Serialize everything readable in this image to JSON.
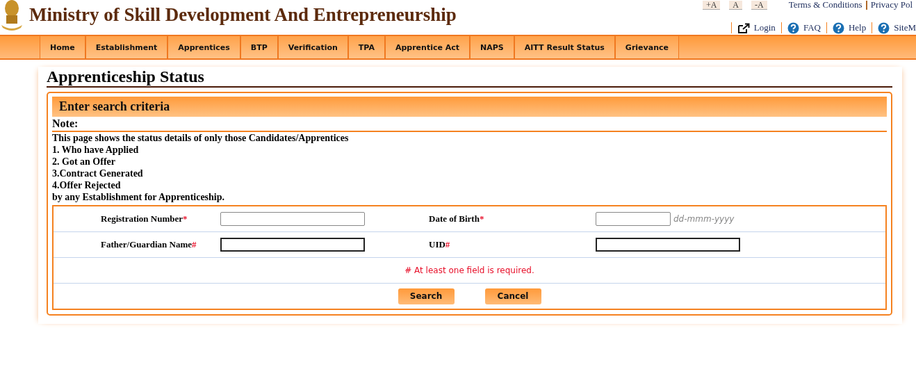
{
  "header": {
    "title": "Ministry of Skill Development And Entrepreneurship"
  },
  "font_size_buttons": [
    "+A",
    "A",
    "-A"
  ],
  "top_links": [
    "Terms & Conditions",
    "Privacy Pol"
  ],
  "utility_links": [
    {
      "kind": "login",
      "label": "Login"
    },
    {
      "kind": "help",
      "label": "FAQ"
    },
    {
      "kind": "help",
      "label": "Help"
    },
    {
      "kind": "help",
      "label": "SiteM"
    }
  ],
  "nav": [
    "Home",
    "Establishment",
    "Apprentices",
    "BTP",
    "Verification",
    "TPA",
    "Apprentice Act",
    "NAPS",
    "AITT Result Status",
    "Grievance"
  ],
  "page_title": "Apprenticeship Status",
  "panel": {
    "title": "Enter search criteria",
    "note_title": "Note:",
    "note_lines": [
      "This page shows the status details of only those Candidates/Apprentices",
      "1. Who have Applied",
      "2. Got an Offer",
      "3.Contract Generated",
      "4.Offer Rejected",
      "by any Establishment for Apprenticeship."
    ]
  },
  "form_rows": [
    [
      {
        "label": "Registration Number",
        "mark": "*",
        "focused": false
      },
      {
        "label": "Date of Birth",
        "mark": "*",
        "focused": false,
        "hint": "dd-mmm-yyyy"
      }
    ],
    [
      {
        "label": "Father/Guardian Name",
        "mark": "#",
        "focused": true
      },
      {
        "label": "UID",
        "mark": "#",
        "focused": true
      }
    ]
  ],
  "required_note": "# At least one field is required.",
  "buttons": [
    "Search",
    "Cancel"
  ]
}
